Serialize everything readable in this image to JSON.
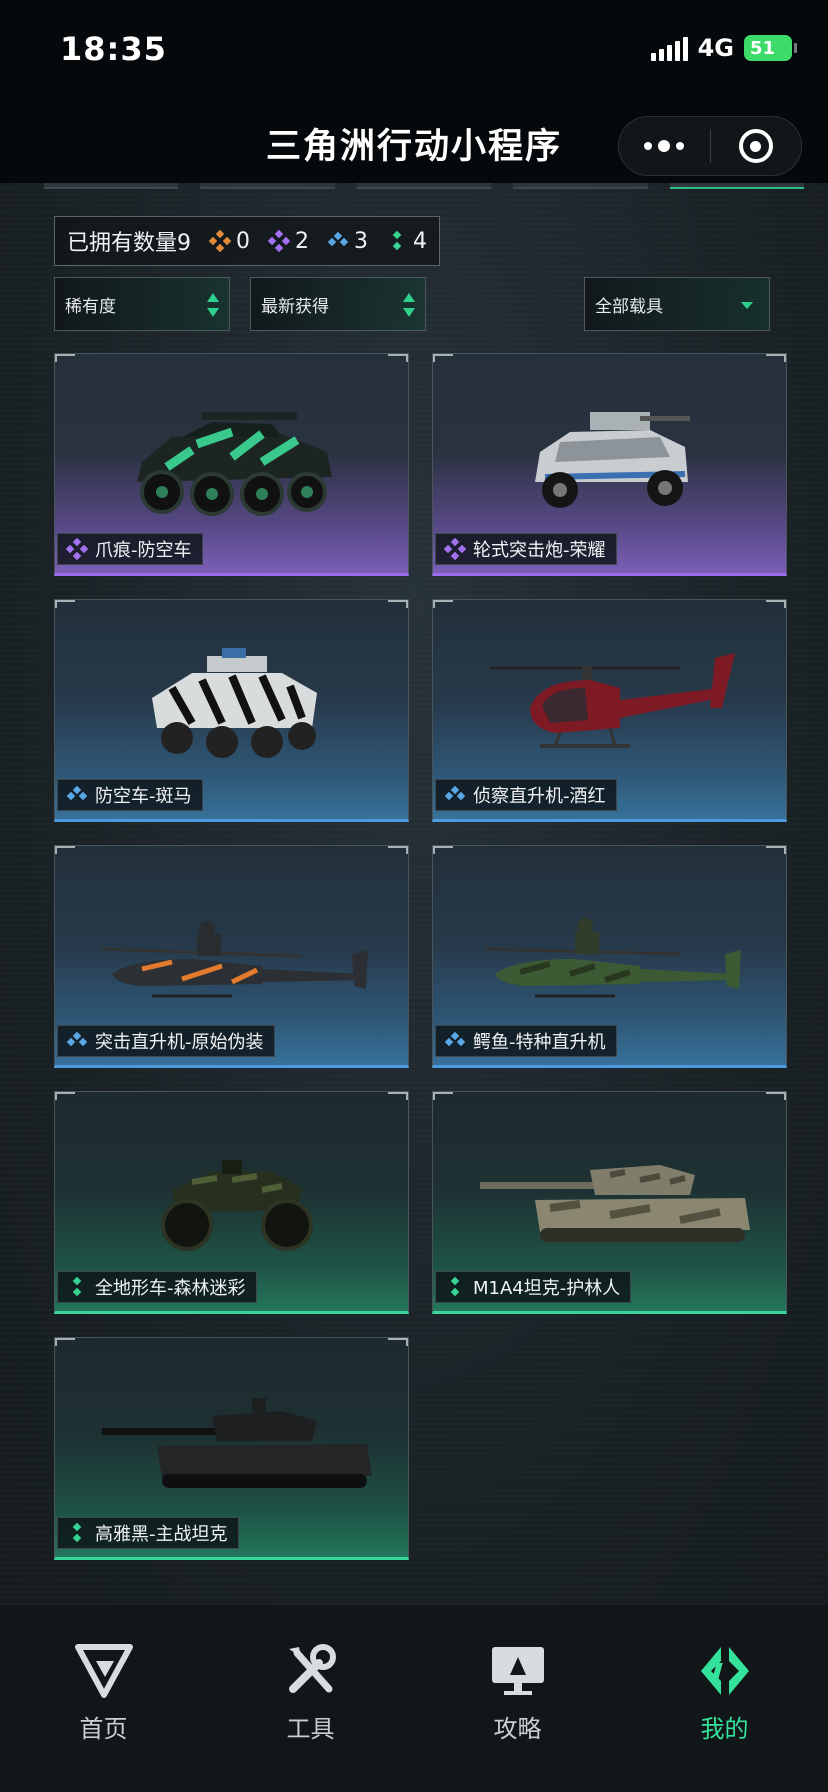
{
  "status_bar": {
    "time": "18:35",
    "network": "4G",
    "battery": "51"
  },
  "nav": {
    "title": "三角洲行动小程序"
  },
  "summary": {
    "owned_label": "已拥有数量9",
    "counts": [
      {
        "rarity": "orange",
        "color": "#e08a3a",
        "value": "0"
      },
      {
        "rarity": "purple",
        "color": "#a272f0",
        "value": "2"
      },
      {
        "rarity": "blue",
        "color": "#5aa7e6",
        "value": "3"
      },
      {
        "rarity": "green",
        "color": "#38d494",
        "value": "4"
      }
    ]
  },
  "filters": {
    "sort_rarity": "稀有度",
    "sort_recent": "最新获得",
    "vehicle_type": "全部载具"
  },
  "cards": [
    {
      "name": "爪痕-防空车",
      "rarity": "purple",
      "vehicle": "apc-8wheel"
    },
    {
      "name": "轮式突击炮-荣耀",
      "rarity": "purple",
      "vehicle": "assault-car"
    },
    {
      "name": "防空车-斑马",
      "rarity": "blue",
      "vehicle": "apc-6wheel"
    },
    {
      "name": "侦察直升机-酒红",
      "rarity": "blue",
      "vehicle": "scout-heli"
    },
    {
      "name": "突击直升机-原始伪装",
      "rarity": "blue",
      "vehicle": "attack-heli-orange"
    },
    {
      "name": "鳄鱼-特种直升机",
      "rarity": "blue",
      "vehicle": "attack-heli-green"
    },
    {
      "name": "全地形车-森林迷彩",
      "rarity": "green",
      "vehicle": "atv"
    },
    {
      "name": "M1A4坦克-护林人",
      "rarity": "green",
      "vehicle": "tank-camo"
    },
    {
      "name": "高雅黑-主战坦克",
      "rarity": "green",
      "vehicle": "tank-black"
    }
  ],
  "tabbar": [
    {
      "label": "首页",
      "icon": "home-logo-icon",
      "active": false
    },
    {
      "label": "工具",
      "icon": "tools-icon",
      "active": false
    },
    {
      "label": "攻略",
      "icon": "guide-monitor-icon",
      "active": false
    },
    {
      "label": "我的",
      "icon": "profile-logo-icon",
      "active": true
    }
  ],
  "colors": {
    "accent": "#35e29b",
    "purple": "#9a6cf0",
    "blue": "#4c9be0",
    "green": "#39d59a"
  }
}
